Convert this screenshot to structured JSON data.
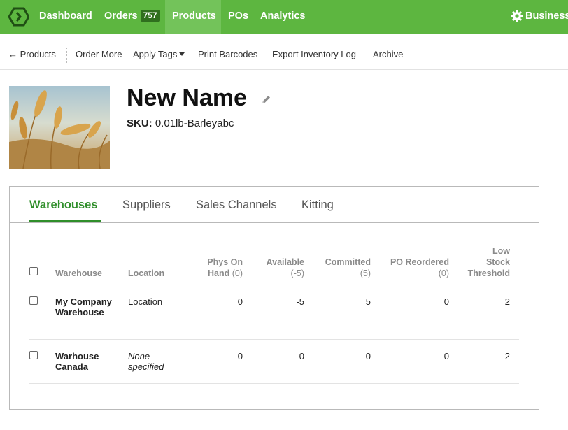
{
  "nav": {
    "items": [
      {
        "label": "Dashboard"
      },
      {
        "label": "Orders",
        "badge": "757"
      },
      {
        "label": "Products"
      },
      {
        "label": "POs"
      },
      {
        "label": "Analytics"
      }
    ],
    "account_label": "Business",
    "active": "Products",
    "brand_color": "#5db640"
  },
  "actions": {
    "back": "← Products",
    "order_more": "Order More",
    "apply_tags": "Apply Tags",
    "print_barcodes": "Print Barcodes",
    "export_log": "Export Inventory Log",
    "archive": "Archive"
  },
  "product": {
    "name": "New Name",
    "sku_label": "SKU:",
    "sku_value": "0.01lb-Barleyabc",
    "image": "wheat-photo"
  },
  "tabs": [
    "Warehouses",
    "Suppliers",
    "Sales Channels",
    "Kitting"
  ],
  "table": {
    "headers": {
      "warehouse": "Warehouse",
      "location": "Location",
      "phys_line1": "Phys On",
      "phys_line2": "Hand",
      "phys_total": "(0)",
      "available": "Available",
      "available_total": "(-5)",
      "committed": "Committed",
      "committed_total": "(5)",
      "po_reordered": "PO Reordered",
      "po_total": "(0)",
      "low_line1": "Low",
      "low_line2": "Stock",
      "low_line3": "Threshold"
    },
    "rows": [
      {
        "warehouse": "My Company Warehouse",
        "location": "Location",
        "phys": "0",
        "available": "-5",
        "committed": "5",
        "po": "0",
        "low": "2"
      },
      {
        "warehouse": "Warhouse Canada",
        "location": "None specified",
        "phys": "0",
        "available": "0",
        "committed": "0",
        "po": "0",
        "low": "2"
      }
    ]
  }
}
